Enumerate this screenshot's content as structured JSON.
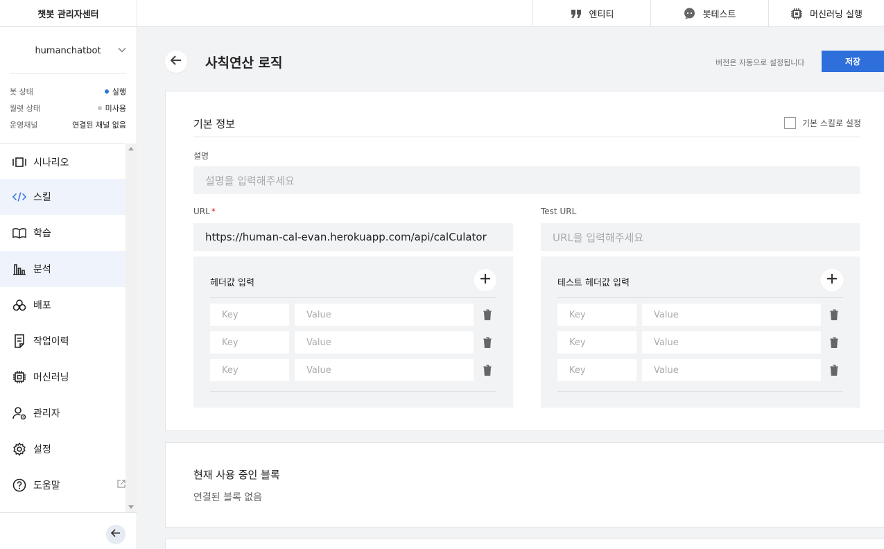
{
  "topbar": {
    "brand": "챗봇 관리자센터",
    "nav": [
      {
        "label": "엔티티",
        "icon": "quote-icon"
      },
      {
        "label": "봇테스트",
        "icon": "chat-bubble-icon"
      },
      {
        "label": "머신러닝 실행",
        "icon": "chip-icon"
      }
    ]
  },
  "sidebar": {
    "bot_name": "humanchatbot",
    "status": [
      {
        "label": "봇 상태",
        "value": "실행",
        "dot_color": "#2f6fdc"
      },
      {
        "label": "월렛 상태",
        "value": "미사용",
        "dot_color": "#c4c4c4"
      },
      {
        "label": "운영채널",
        "value": "연결된 채널 없음"
      }
    ],
    "menu": [
      {
        "label": "시나리오",
        "icon": "scenario-icon"
      },
      {
        "label": "스킬",
        "icon": "code-icon",
        "active": true
      },
      {
        "label": "학습",
        "icon": "book-icon"
      },
      {
        "label": "분석",
        "icon": "bar-chart-icon"
      },
      {
        "label": "배포",
        "icon": "deploy-icon"
      },
      {
        "label": "작업이력",
        "icon": "history-icon"
      },
      {
        "label": "머신러닝",
        "icon": "chip-icon"
      },
      {
        "label": "관리자",
        "icon": "admin-icon"
      },
      {
        "label": "설정",
        "icon": "gear-icon"
      },
      {
        "label": "도움말",
        "icon": "help-icon",
        "external": true
      }
    ]
  },
  "page": {
    "title": "사칙연산 로직",
    "version_note": "버전은 자동으로 설정됩니다",
    "save_label": "저장"
  },
  "basic_info": {
    "title": "기본 정보",
    "default_skill_label": "기본 스킬로 설정",
    "default_skill_checked": false,
    "description_label": "설명",
    "description_placeholder": "설명을 입력해주세요",
    "url_label": "URL",
    "url_required_mark": "*",
    "url_value": "https://human-cal-evan.herokuapp.com/api/calCulator",
    "test_url_label": "Test URL",
    "test_url_placeholder": "URL을 입력해주세요",
    "header_title": "헤더값 입력",
    "test_header_title": "테스트 헤더값 입력",
    "key_placeholder": "Key",
    "value_placeholder": "Value"
  },
  "blocks": {
    "title": "현재 사용 중인 블록",
    "empty": "연결된 블록 없음"
  },
  "colors": {
    "accent": "#2f6fdc",
    "required": "#e02424",
    "active_bg": "#eef3fc"
  }
}
